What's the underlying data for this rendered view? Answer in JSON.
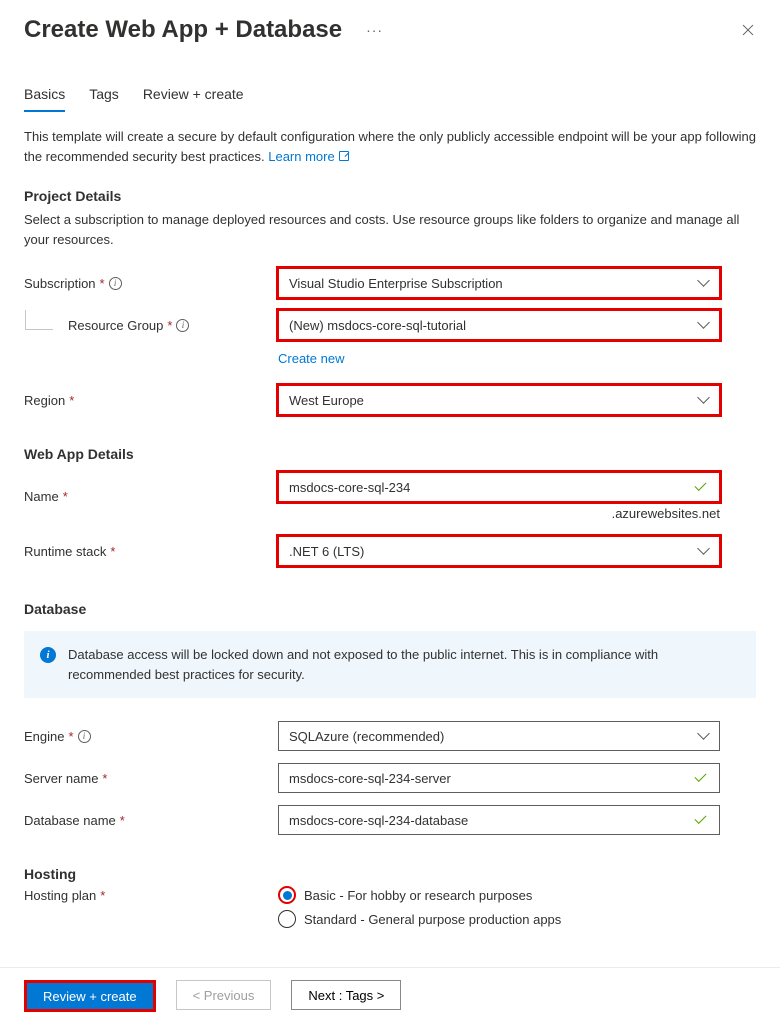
{
  "header": {
    "title": "Create Web App + Database"
  },
  "tabs": {
    "basics": "Basics",
    "tags": "Tags",
    "review": "Review + create"
  },
  "intro": {
    "text": "This template will create a secure by default configuration where the only publicly accessible endpoint will be your app following the recommended security best practices.  ",
    "learn_more": "Learn more"
  },
  "sections": {
    "project_details": {
      "title": "Project Details",
      "desc": "Select a subscription to manage deployed resources and costs. Use resource groups like folders to organize and manage all your resources."
    },
    "web_app_details": {
      "title": "Web App Details"
    },
    "database": {
      "title": "Database",
      "callout": "Database access will be locked down and not exposed to the public internet. This is in compliance with recommended best practices for security."
    },
    "hosting": {
      "title": "Hosting"
    }
  },
  "fields": {
    "subscription": {
      "label": "Subscription",
      "value": "Visual Studio Enterprise Subscription"
    },
    "resource_group": {
      "label": "Resource Group",
      "value": "(New) msdocs-core-sql-tutorial",
      "create_new": "Create new"
    },
    "region": {
      "label": "Region",
      "value": "West Europe"
    },
    "name": {
      "label": "Name",
      "value": "msdocs-core-sql-234",
      "suffix": ".azurewebsites.net"
    },
    "runtime": {
      "label": "Runtime stack",
      "value": ".NET 6 (LTS)"
    },
    "engine": {
      "label": "Engine",
      "value": "SQLAzure (recommended)"
    },
    "server_name": {
      "label": "Server name",
      "value": "msdocs-core-sql-234-server"
    },
    "database_name": {
      "label": "Database name",
      "value": "msdocs-core-sql-234-database"
    },
    "hosting_plan": {
      "label": "Hosting plan",
      "options": {
        "basic": "Basic - For hobby or research purposes",
        "standard": "Standard - General purpose production apps"
      }
    }
  },
  "footer": {
    "review_create": "Review + create",
    "previous": "< Previous",
    "next": "Next : Tags >"
  }
}
